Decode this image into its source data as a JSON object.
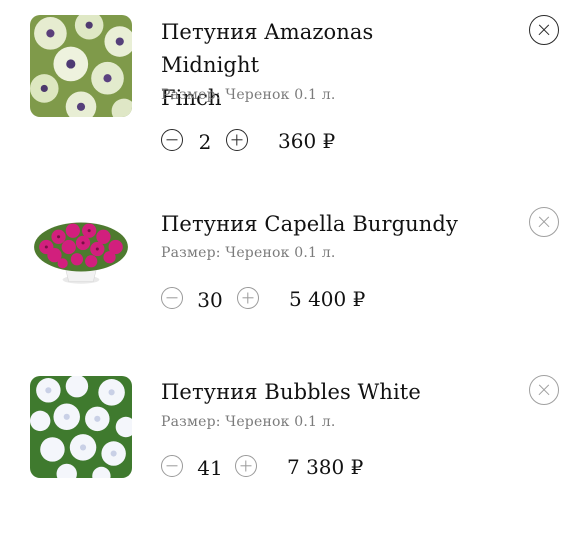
{
  "cart": {
    "items": [
      {
        "title_line1": "Петуния Amazonas Midnight",
        "title_line2": "Finch",
        "size": "Размер: Черенок 0.1 л.",
        "quantity": "2",
        "price": "360 ₽",
        "image_icon": "petunia-amazonas-midnight-finch-photo"
      },
      {
        "title": "Петуния Capella Burgundy",
        "size": "Размер: Черенок 0.1 л.",
        "quantity": "30",
        "price": "5 400 ₽",
        "image_icon": "petunia-capella-burgundy-photo"
      },
      {
        "title": "Петуния Bubbles White",
        "size": "Размер: Черенок 0.1 л.",
        "quantity": "41",
        "price": "7 380 ₽",
        "image_icon": "petunia-bubbles-white-photo"
      }
    ]
  }
}
